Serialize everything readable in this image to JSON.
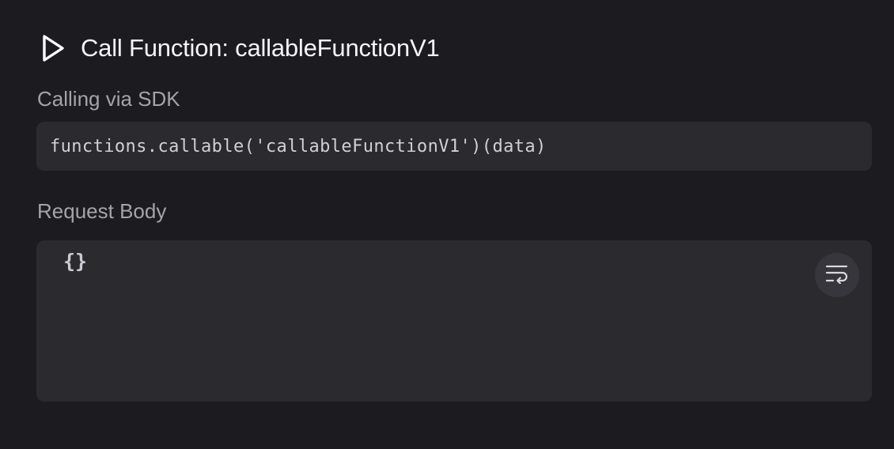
{
  "header": {
    "icon": "play-icon",
    "title": "Call Function: callableFunctionV1"
  },
  "sdk_section": {
    "label": "Calling via SDK",
    "code": "functions.callable('callableFunctionV1')(data)"
  },
  "request_body_section": {
    "label": "Request Body",
    "value": "{}",
    "wrap_button_icon": "word-wrap-icon"
  },
  "colors": {
    "background": "#1c1c20",
    "box_background": "#2a2a2f",
    "label_text": "#a3a3ab",
    "title_text": "#f5f5f7"
  }
}
